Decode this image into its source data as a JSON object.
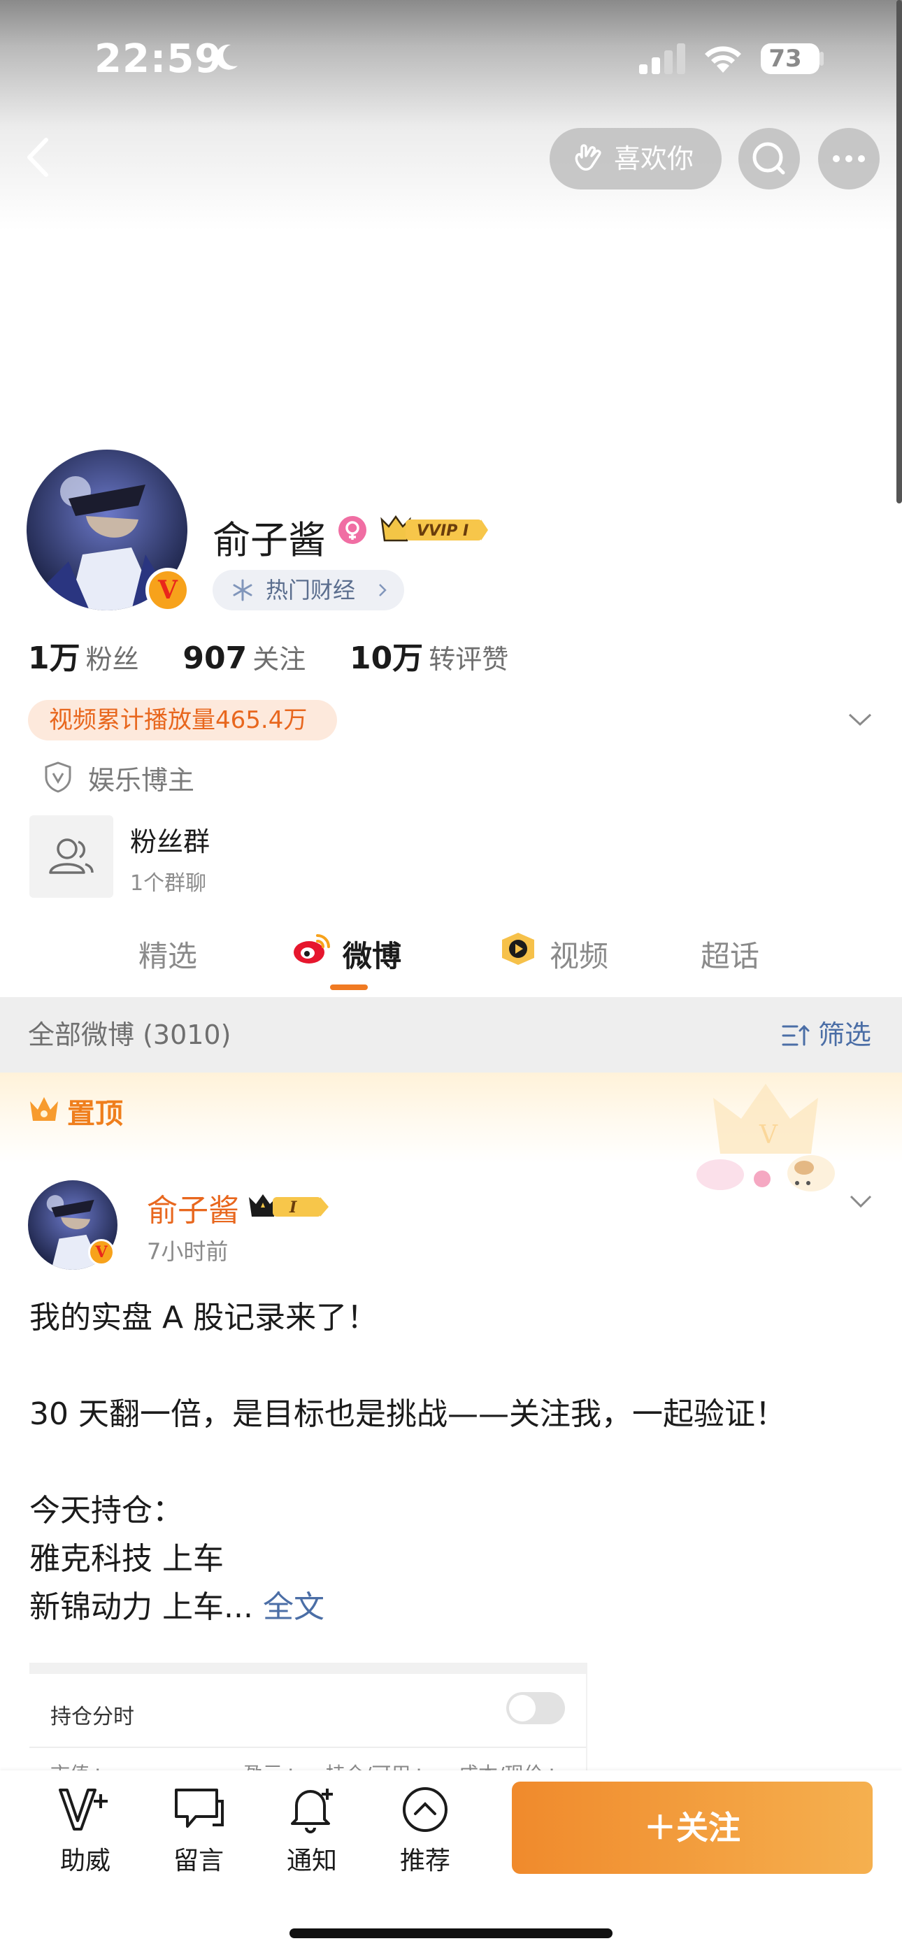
{
  "status_bar": {
    "time": "22:59",
    "battery": "73"
  },
  "header": {
    "like_label": "喜欢你"
  },
  "profile": {
    "name": "俞子酱",
    "vip_label": "VVIP I",
    "topic_label": "热门财经",
    "stats": [
      {
        "value": "1万",
        "label": "粉丝"
      },
      {
        "value": "907",
        "label": "关注"
      },
      {
        "value": "10万",
        "label": "转评赞"
      }
    ],
    "play_count": "视频累计播放量465.4万",
    "tag": "娱乐博主",
    "group": {
      "title": "粉丝群",
      "subtitle": "1个群聊"
    }
  },
  "tabs": [
    {
      "label": "精选"
    },
    {
      "label": "微博"
    },
    {
      "label": "视频"
    },
    {
      "label": "超话"
    }
  ],
  "filter": {
    "all_label": "全部微博 (3010)",
    "filter_label": "筛选"
  },
  "pinned": {
    "label": "置顶"
  },
  "post": {
    "author": "俞子酱",
    "vip_level": "I",
    "time": "7小时前",
    "lines": [
      "我的实盘 A 股记录来了！",
      "30 天翻一倍，是目标也是挑战——关注我，一起验证！",
      "今天持仓：",
      "雅克科技 上车",
      "新锦动力 上车..."
    ],
    "full_text": "全文",
    "card": {
      "title": "持仓分时",
      "columns": [
        "市值≑",
        "盈亏≑",
        "持仓/可用≑",
        "成本/现价≑"
      ]
    }
  },
  "bottom_bar": {
    "items": [
      {
        "label": "助威"
      },
      {
        "label": "留言"
      },
      {
        "label": "通知"
      },
      {
        "label": "推荐"
      }
    ],
    "follow_label": "＋关注"
  },
  "colors": {
    "accent": "#f07a22",
    "link": "#4b6ea6"
  }
}
